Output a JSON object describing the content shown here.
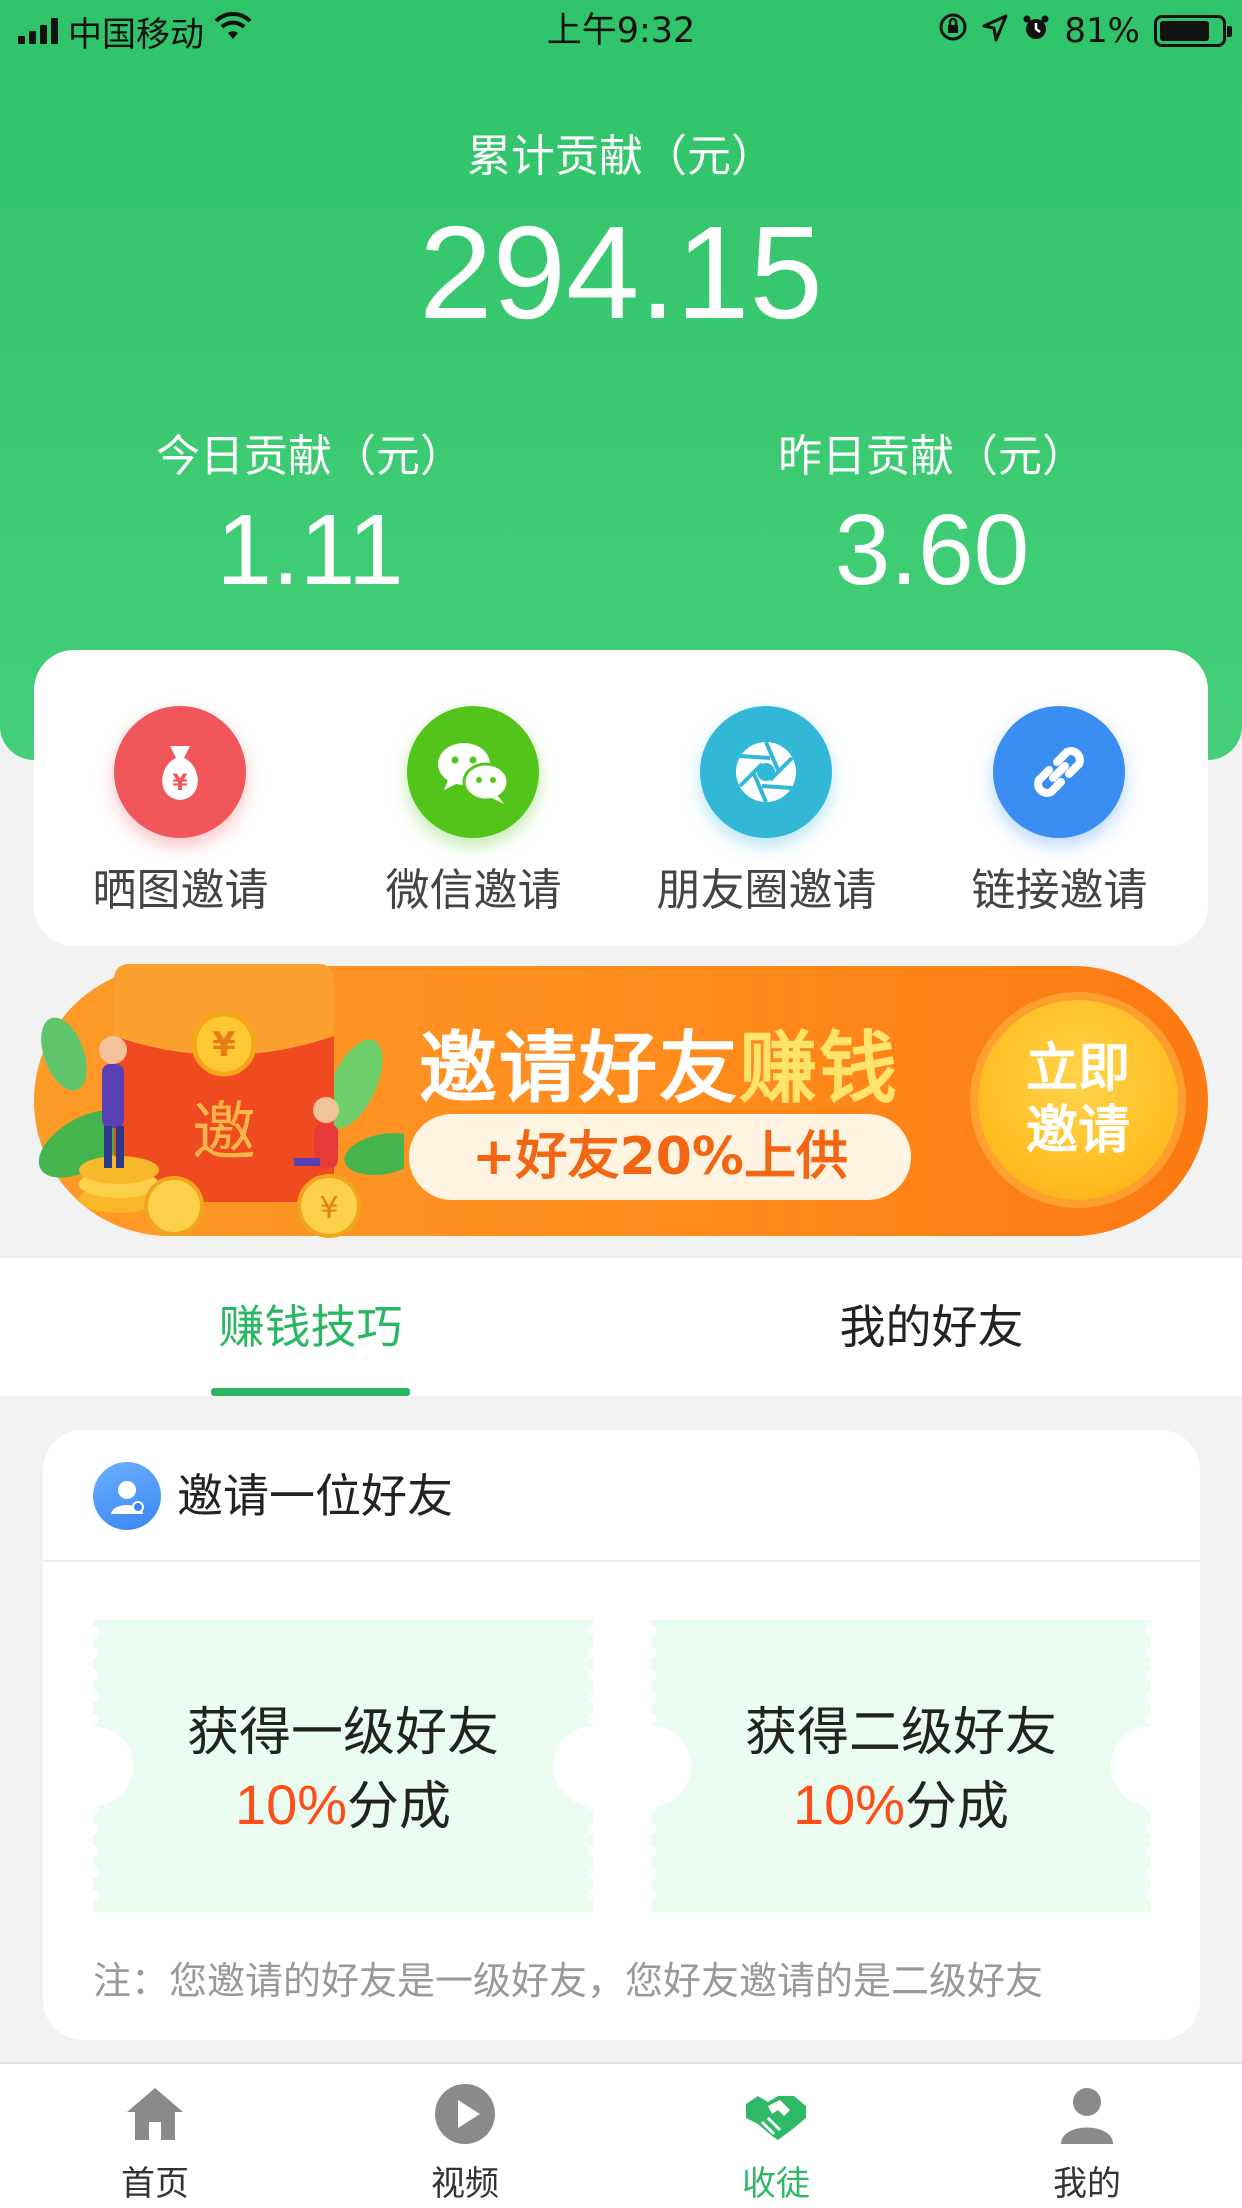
{
  "status_bar": {
    "carrier": "中国移动",
    "time": "上午9:32",
    "battery": "81%"
  },
  "summary": {
    "total_label": "累计贡献（元）",
    "total_value": "294.15",
    "today_label": "今日贡献（元）",
    "today_value": "1.11",
    "yesterday_label": "昨日贡献（元）",
    "yesterday_value": "3.60"
  },
  "invite_methods": [
    {
      "label": "晒图邀请",
      "icon": "money-bag-icon",
      "color": "#f0565a"
    },
    {
      "label": "微信邀请",
      "icon": "wechat-icon",
      "color": "#52c41a"
    },
    {
      "label": "朋友圈邀请",
      "icon": "moments-shutter-icon",
      "color": "#33b7d6"
    },
    {
      "label": "链接邀请",
      "icon": "link-icon",
      "color": "#3a8ef2"
    }
  ],
  "banner": {
    "title_main": "邀请好友",
    "title_highlight": "赚钱",
    "subtitle": "+好友20%上供",
    "button_line1": "立即",
    "button_line2": "邀请",
    "envelope_char": "邀"
  },
  "tabs": [
    {
      "label": "赚钱技巧",
      "active": true
    },
    {
      "label": "我的好友",
      "active": false
    }
  ],
  "tips": {
    "title": "邀请一位好友",
    "tickets": [
      {
        "line1": "获得一级好友",
        "percent": "10%",
        "suffix": "分成"
      },
      {
        "line1": "获得二级好友",
        "percent": "10%",
        "suffix": "分成"
      }
    ],
    "note": "注：您邀请的好友是一级好友，您好友邀请的是二级好友"
  },
  "bottom_nav": [
    {
      "label": "首页",
      "icon": "home-icon",
      "active": false
    },
    {
      "label": "视频",
      "icon": "play-icon",
      "active": false
    },
    {
      "label": "收徒",
      "icon": "handshake-icon",
      "active": true
    },
    {
      "label": "我的",
      "icon": "user-icon",
      "active": false
    }
  ],
  "colors": {
    "primary_green": "#2fc36a",
    "accent_orange": "#ff8a1c",
    "percent_red": "#ff4d1a"
  }
}
